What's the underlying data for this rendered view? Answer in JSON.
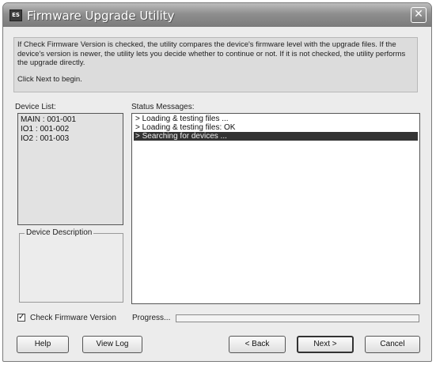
{
  "window": {
    "title": "Firmware Upgrade Utility",
    "app_icon_text": "ES",
    "close_glyph": "✕"
  },
  "info": {
    "paragraph": "If Check Firmware Version is checked, the utility compares the device's firmware level with the upgrade files. If the device's version is newer, the utility lets you decide whether to continue or not. If it is not checked, the utility performs the upgrade directly.",
    "prompt": "Click Next to begin."
  },
  "device_list": {
    "label": "Device List:",
    "items": [
      {
        "label": "MAIN : 001-001"
      },
      {
        "label": "IO1 : 001-002"
      },
      {
        "label": "IO2 : 001-003"
      }
    ]
  },
  "device_description": {
    "label": "Device Description"
  },
  "status": {
    "label": "Status Messages:",
    "messages": [
      {
        "text": "> Loading & testing files ..."
      },
      {
        "text": "> Loading & testing files: OK"
      },
      {
        "text": "> Searching for devices ..."
      }
    ],
    "selected_index": 2
  },
  "check_firmware": {
    "label": "Check Firmware Version",
    "checked": true,
    "check_glyph": "✓"
  },
  "progress": {
    "label": "Progress...",
    "value": 0
  },
  "buttons": {
    "help": "Help",
    "view_log": "View Log",
    "back": "< Back",
    "next": "Next >",
    "cancel": "Cancel"
  },
  "colors": {
    "titlebar": "#8e8e8e",
    "selection": "#333333",
    "panel": "#ececec"
  },
  "icons": {
    "app": "app-logo-icon",
    "close": "close-icon",
    "checkbox": "check-icon"
  }
}
